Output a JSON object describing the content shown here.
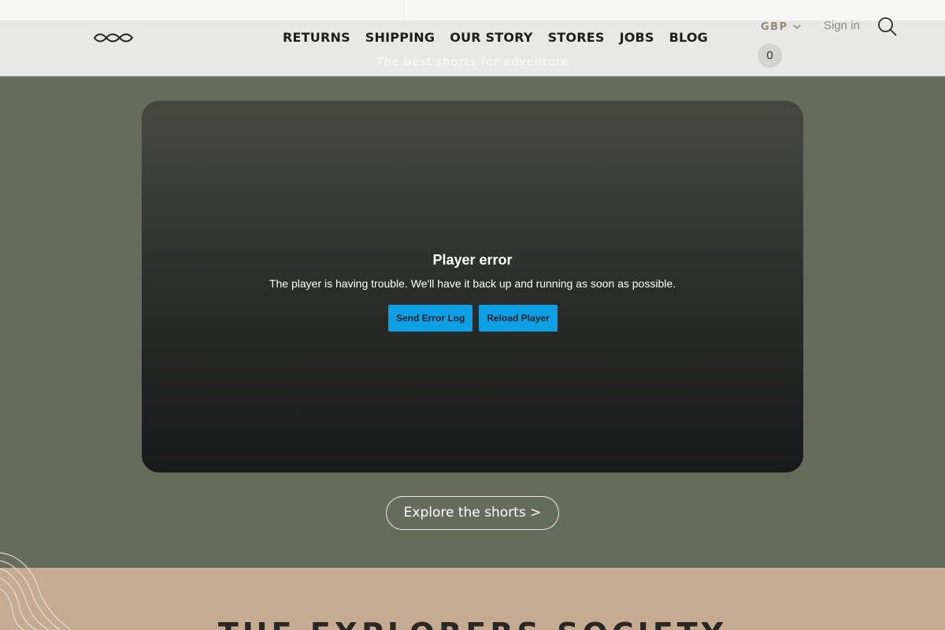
{
  "header": {
    "nav": [
      "RETURNS",
      "SHIPPING",
      "OUR STORY",
      "STORES",
      "JOBS",
      "BLOG"
    ],
    "tagline": "The best shorts for adventure",
    "currency": "GBP",
    "signin": "Sign in",
    "cart_count": "0"
  },
  "player": {
    "error_title": "Player error",
    "error_message": "The player is having trouble. We'll have it back up and running as soon as possible.",
    "send_log_label": "Send Error Log",
    "reload_label": "Reload Player"
  },
  "cta": {
    "explore_label": "Explore the shorts >"
  },
  "section": {
    "title": "THE EXPLORERS SOCIETY"
  },
  "colors": {
    "page_green": "#666c5b",
    "header_bg": "#e8e9e6",
    "button_blue": "#0ea0e5",
    "section_tan": "#c5ab92"
  }
}
